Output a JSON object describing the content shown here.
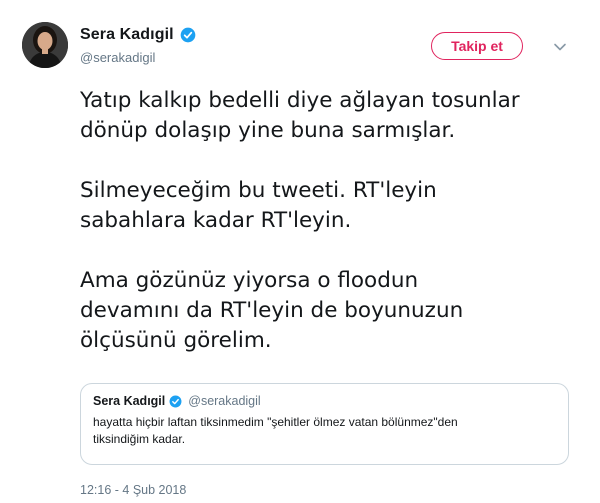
{
  "author": {
    "display_name": "Sera Kadıgil",
    "handle": "@serakadigil"
  },
  "follow_button": {
    "label": "Takip et"
  },
  "tweet": {
    "paragraphs": [
      [
        "Yatıp kalkıp bedelli diye ağlayan tosunlar",
        "dönüp dolaşıp yine buna sarmışlar."
      ],
      [
        "Silmeyeceğim bu tweeti. RT'leyin",
        "sabahlara kadar RT'leyin."
      ],
      [
        "Ama gözünüz yiyorsa o floodun",
        "devamını da RT'leyin de boyunuzun",
        "ölçüsünü görelim."
      ]
    ],
    "timestamp": "12:16 - 4 Şub 2018"
  },
  "quoted_tweet": {
    "display_name": "Sera Kadıgil",
    "handle": "@serakadigil",
    "lines": [
      "hayatta hiçbir laftan tiksinmedim \"şehitler ölmez vatan bölünmez\"den",
      "tiksindiğim kadar."
    ]
  },
  "icons": {
    "verified": "verified-badge-icon",
    "caret": "chevron-down-icon"
  },
  "colors": {
    "accent": "#e0245e",
    "verified": "#1da1f2",
    "secondary_text": "#657786",
    "border": "#ccd6dd"
  }
}
